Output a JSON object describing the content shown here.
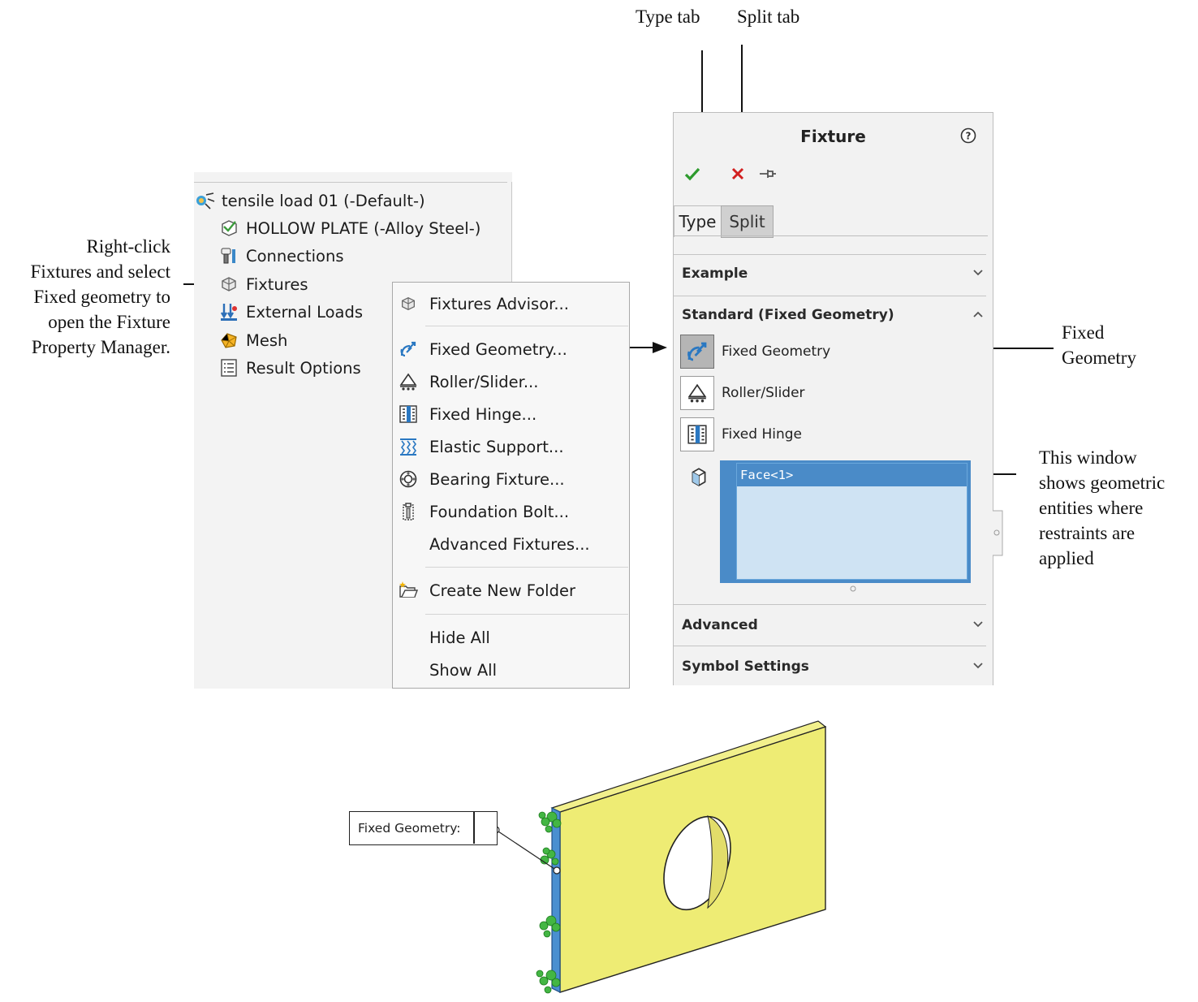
{
  "annotations": {
    "type_tab": "Type tab",
    "split_tab": "Split tab",
    "right_click_note": [
      "Right-click",
      "Fixtures and select",
      "Fixed geometry to",
      "open the Fixture",
      "Property Manager."
    ],
    "fixed_geometry_note": [
      "Fixed",
      "Geometry"
    ],
    "window_note": [
      "This window",
      "shows geometric",
      "entities where",
      "restraints are",
      "applied"
    ]
  },
  "tree": {
    "items": [
      {
        "label": "tensile load 01 (-Default-)",
        "icon": "study-icon"
      },
      {
        "label": "HOLLOW PLATE (-Alloy Steel-)",
        "icon": "part-icon"
      },
      {
        "label": "Connections",
        "icon": "connections-icon"
      },
      {
        "label": "Fixtures",
        "icon": "fixtures-icon"
      },
      {
        "label": "External Loads",
        "icon": "external-loads-icon"
      },
      {
        "label": "Mesh",
        "icon": "mesh-icon"
      },
      {
        "label": "Result Options",
        "icon": "result-options-icon"
      }
    ]
  },
  "context_menu": {
    "items": [
      {
        "label": "Fixtures Advisor...",
        "icon": "fixtures-advisor-icon"
      },
      {
        "label": "Fixed Geometry...",
        "icon": "fixed-geometry-icon"
      },
      {
        "label": "Roller/Slider...",
        "icon": "roller-slider-icon"
      },
      {
        "label": "Fixed Hinge...",
        "icon": "fixed-hinge-icon"
      },
      {
        "label": "Elastic Support...",
        "icon": "elastic-support-icon"
      },
      {
        "label": "Bearing Fixture...",
        "icon": "bearing-fixture-icon"
      },
      {
        "label": "Foundation Bolt...",
        "icon": "foundation-bolt-icon"
      },
      {
        "label": "Advanced Fixtures...",
        "icon": ""
      },
      {
        "label": "Create New Folder",
        "icon": "new-folder-icon"
      },
      {
        "label": "Hide All",
        "icon": ""
      },
      {
        "label": "Show All",
        "icon": ""
      }
    ]
  },
  "property_manager": {
    "title": "Fixture",
    "tabs": {
      "type": "Type",
      "split": "Split"
    },
    "sections": {
      "example": "Example",
      "standard": "Standard (Fixed Geometry)",
      "advanced": "Advanced",
      "symbol_settings": "Symbol Settings"
    },
    "options": {
      "fixed_geometry": "Fixed Geometry",
      "roller_slider": "Roller/Slider",
      "fixed_hinge": "Fixed Hinge"
    },
    "selection": [
      "Face<1>"
    ],
    "colors": {
      "ok": "#2e9b2e",
      "cancel": "#d22020",
      "selection": "#4a8bc8"
    }
  },
  "model": {
    "callout_label": "Fixed Geometry:",
    "colors": {
      "plate": "#eeec74",
      "fixed_face": "#4a8fd0",
      "symbol": "#45b845"
    }
  }
}
